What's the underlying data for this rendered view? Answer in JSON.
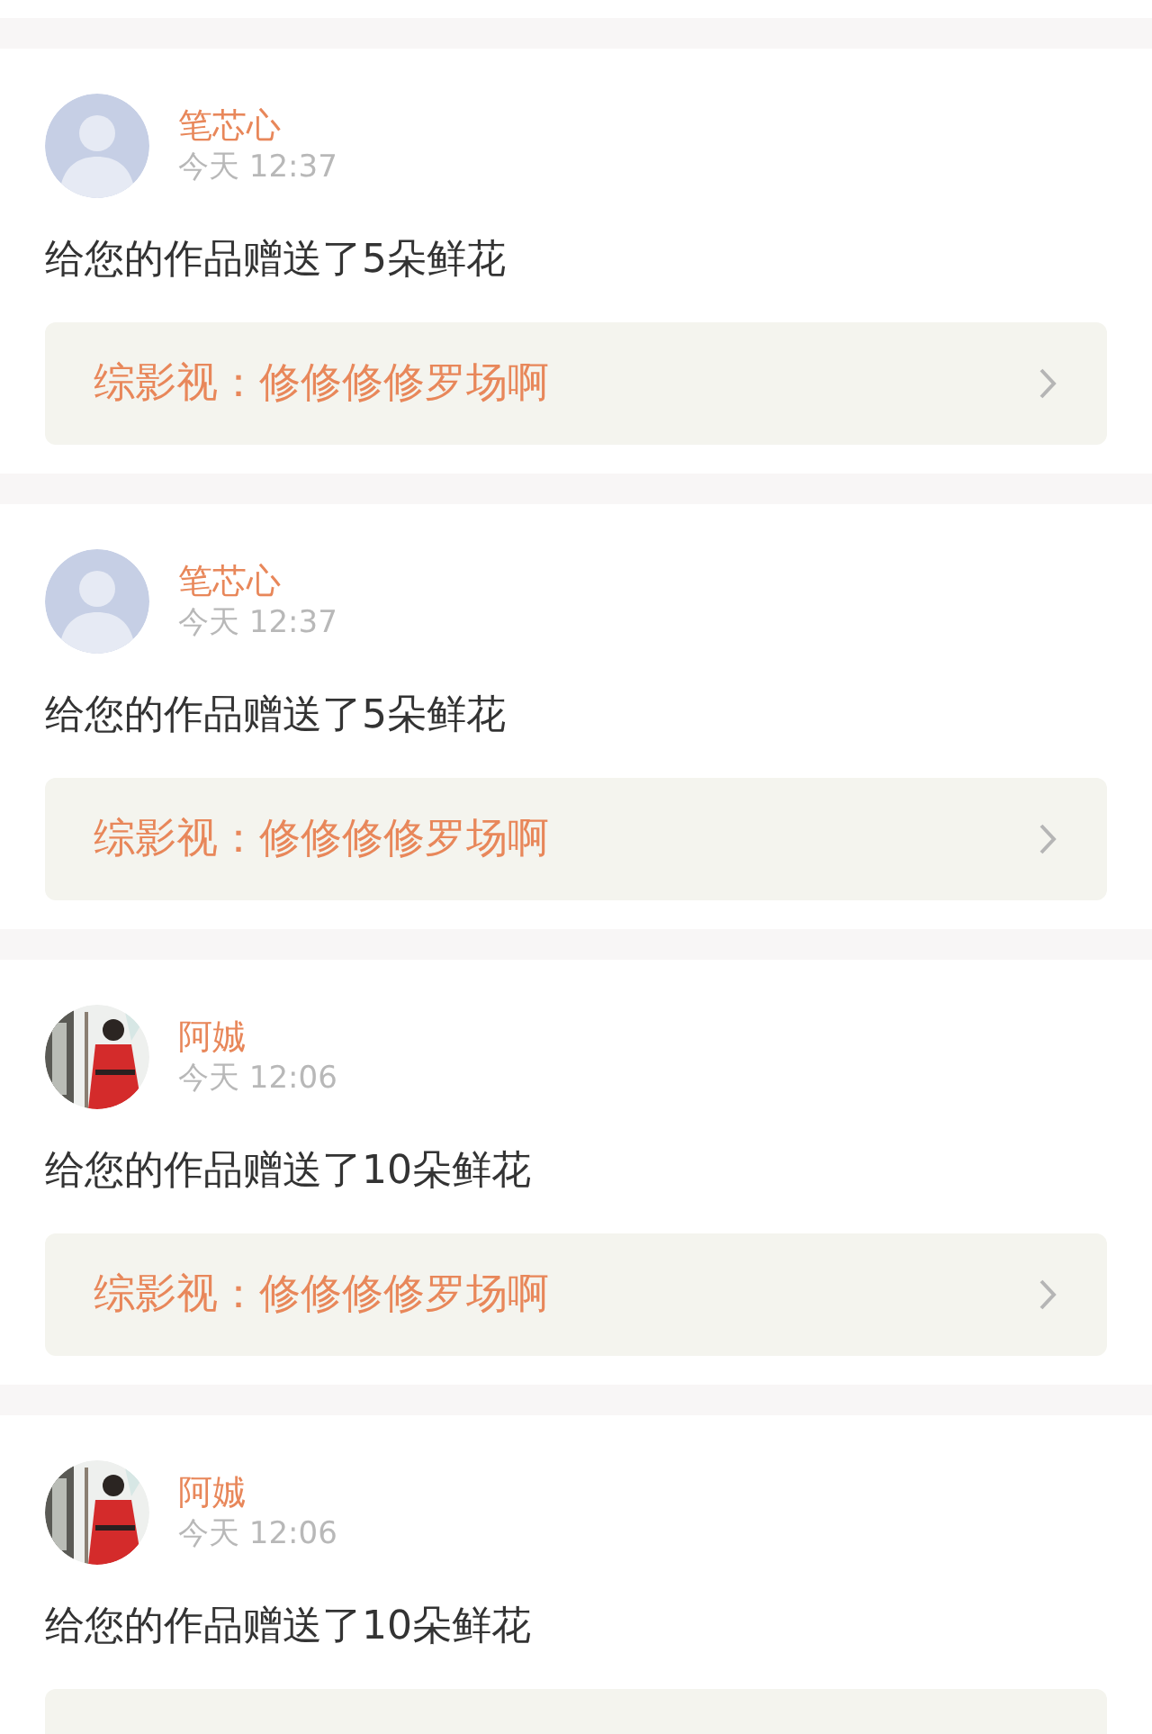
{
  "notifications": [
    {
      "avatar": {
        "kind": "default"
      },
      "name": "笔芯心",
      "time": "今天 12:37",
      "message": "给您的作品赠送了5朵鲜花",
      "link": {
        "title": "综影视：修修修修罗场啊"
      }
    },
    {
      "avatar": {
        "kind": "default"
      },
      "name": "笔芯心",
      "time": "今天 12:37",
      "message": "给您的作品赠送了5朵鲜花",
      "link": {
        "title": "综影视：修修修修罗场啊"
      }
    },
    {
      "name": "阿娍",
      "time": "今天 12:06",
      "message": "给您的作品赠送了10朵鲜花",
      "link": {
        "title": "综影视：修修修修罗场啊"
      }
    },
    {
      "name": "阿娍",
      "time": "今天 12:06",
      "message": "给您的作品赠送了10朵鲜花",
      "link": {
        "cut": true
      }
    }
  ]
}
